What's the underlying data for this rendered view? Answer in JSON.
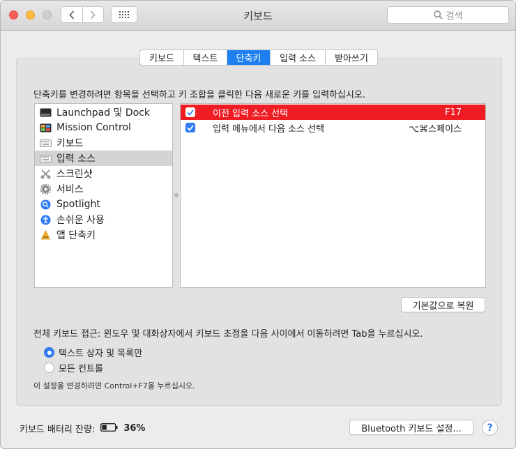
{
  "window": {
    "title": "키보드"
  },
  "search": {
    "placeholder": "검색"
  },
  "tabs": [
    {
      "label": "키보드",
      "active": false
    },
    {
      "label": "텍스트",
      "active": false
    },
    {
      "label": "단축키",
      "active": true
    },
    {
      "label": "입력 소스",
      "active": false
    },
    {
      "label": "받아쓰기",
      "active": false
    }
  ],
  "instruction": "단축키를 변경하려면 항목을 선택하고 키 조합을 클릭한 다음 새로운 키를 입력하십시오.",
  "categories": [
    {
      "label": "Launchpad 및 Dock",
      "icon": "launchpad-icon",
      "selected": false
    },
    {
      "label": "Mission Control",
      "icon": "mission-control-icon",
      "selected": false
    },
    {
      "label": "키보드",
      "icon": "keyboard-icon",
      "selected": false
    },
    {
      "label": "입력 소스",
      "icon": "input-source-icon",
      "selected": true
    },
    {
      "label": "스크린샷",
      "icon": "screenshot-icon",
      "selected": false
    },
    {
      "label": "서비스",
      "icon": "gear-icon",
      "selected": false
    },
    {
      "label": "Spotlight",
      "icon": "spotlight-icon",
      "selected": false
    },
    {
      "label": "손쉬운 사용",
      "icon": "accessibility-icon",
      "selected": false
    },
    {
      "label": "앱 단축키",
      "icon": "app-shortcuts-icon",
      "selected": false
    }
  ],
  "shortcuts": [
    {
      "label": "이전 입력 소스 선택",
      "key": "F17",
      "checked": true,
      "selected": true
    },
    {
      "label": "입력 메뉴에서 다음 소스 선택",
      "key": "⌥⌘스페이스",
      "checked": true,
      "selected": false
    }
  ],
  "restore_button": "기본값으로 복원",
  "full_keyboard_access": {
    "label": "전체 키보드 접근: 윈도우 및 대화상자에서 키보드 초점을 다음 사이에서 이동하려면 Tab을 누르십시오.",
    "options": [
      {
        "label": "텍스트 상자 및 목록만",
        "selected": true
      },
      {
        "label": "모든 컨트롤",
        "selected": false
      }
    ],
    "note": "이 설정을 변경하려면 Control+F7을 누르십시오."
  },
  "battery": {
    "label": "키보드 배터리 잔량:",
    "level": "36%"
  },
  "bluetooth_button": "Bluetooth 키보드 설정...",
  "help_button": "?",
  "colors": {
    "accent": "#2f7cf6",
    "selection": "#ef1c24",
    "active_tab": "#1e80f0"
  }
}
